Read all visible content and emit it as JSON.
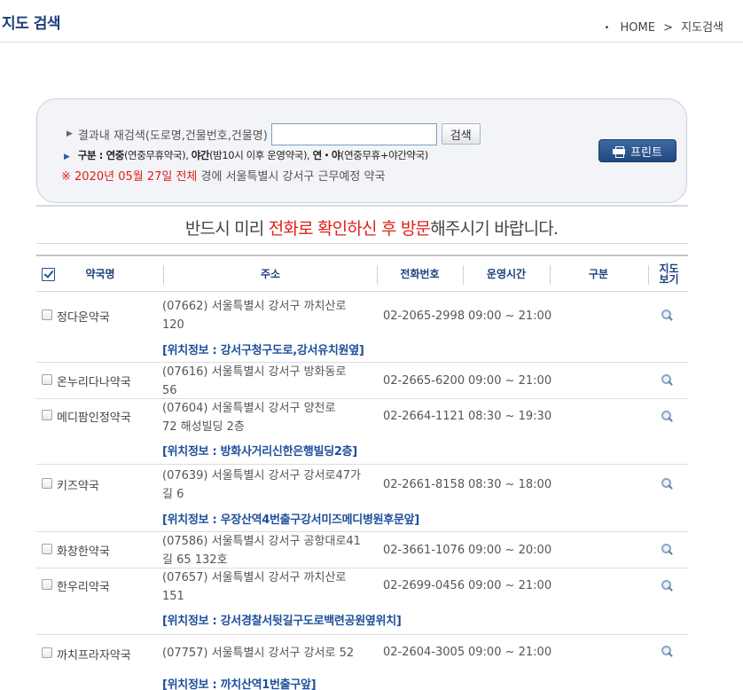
{
  "header": {
    "title": "지도 검색",
    "breadcrumb_home": "HOME",
    "breadcrumb_sep": ">",
    "breadcrumb_current": "지도검색"
  },
  "search": {
    "label": "결과내 재검색(도로명,건물번호,건물명)",
    "input_value": "",
    "button": "검색",
    "print_button": "프린트",
    "legend": {
      "prefix": "구분 : ",
      "t1": "연중",
      "d1": "(연중무휴약국), ",
      "t2": "야간",
      "d2": "(밤10시 이후 운영약국), ",
      "t3": "연・야",
      "d3": "(연중무휴+야간약국)"
    },
    "date_mark": "※ 2020년 05월 27일 전체",
    "date_rest": " 경에  서울특별시  강서구    근무예정 약국"
  },
  "notice": {
    "part1": "반드시 미리 ",
    "part2": "전화로 확인하신 후 방문",
    "part3": "해주시기 바랍니다."
  },
  "table": {
    "headers": {
      "name": "약국명",
      "address": "주소",
      "phone": "전화번호",
      "hours": "운영시간",
      "type": "구분",
      "map_line1": "지도",
      "map_line2": "보기"
    },
    "rows": [
      {
        "name": "정다운약국",
        "addr1": "(07662) 서울특별시 강서구 까치산로",
        "addr2": "120",
        "phone": "02-2065-2998",
        "hours": "09:00 ~ 21:00",
        "type": "",
        "location": "[위치정보 : 강서구청구도로,강서유치원옆]"
      },
      {
        "name": "온누리다나약국",
        "addr1": "(07616) 서울특별시 강서구 방화동로",
        "addr2": "56",
        "phone": "02-2665-6200",
        "hours": "09:00 ~ 21:00",
        "type": "",
        "location": ""
      },
      {
        "name": "메디팜인정약국",
        "addr1": "(07604) 서울특별시 강서구 양천로",
        "addr2": "72 해성빌딩 2층",
        "phone": "02-2664-1121",
        "hours": "08:30 ~ 19:30",
        "type": "",
        "location": "[위치정보 : 방화사거리신한은행빌딩2층]"
      },
      {
        "name": "키즈약국",
        "addr1": "(07639) 서울특별시 강서구 강서로47가",
        "addr2": "길 6",
        "phone": "02-2661-8158",
        "hours": "08:30 ~ 18:00",
        "type": "",
        "location": "[위치정보 : 우장산역4번출구강서미즈메디병원후문앞]"
      },
      {
        "name": "화창한약국",
        "addr1": "(07586) 서울특별시 강서구 공항대로41",
        "addr2": "길 65 132호",
        "phone": "02-3661-1076",
        "hours": "09:00 ~ 20:00",
        "type": "",
        "location": ""
      },
      {
        "name": "한우리약국",
        "addr1": "(07657) 서울특별시 강서구 까치산로",
        "addr2": "151",
        "phone": "02-2699-0456",
        "hours": "09:00 ~ 21:00",
        "type": "",
        "location": "[위치정보 : 강서경찰서뒷길구도로백련공원옆위치]"
      },
      {
        "name": "까치프라자약국",
        "addr1": "(07757) 서울특별시 강서구 강서로 52",
        "addr2": "",
        "phone": "02-2604-3005",
        "hours": "09:00 ~ 21:00",
        "type": "",
        "location": "[위치정보 : 까치산역1번출구앞]"
      }
    ]
  },
  "colors": {
    "title_blue": "#1e3f7a",
    "link_blue": "#1d4f9b",
    "red": "#e0201a"
  },
  "icons": {
    "map_view": "magnifier-icon",
    "print": "printer-icon",
    "legend_bullet": "triangle-icon"
  }
}
